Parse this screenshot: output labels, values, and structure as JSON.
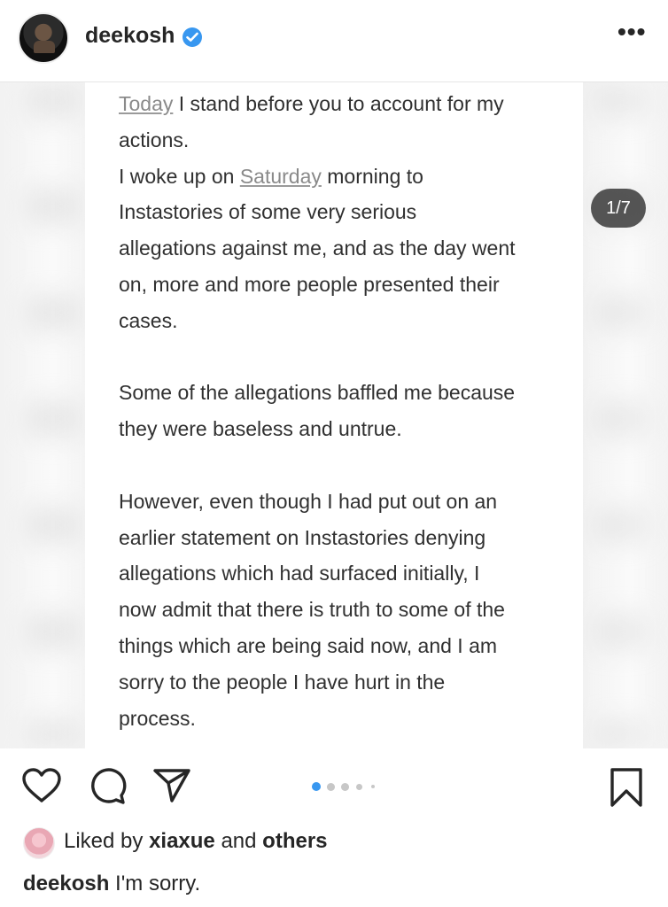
{
  "header": {
    "username": "deekosh",
    "more_label": "•••"
  },
  "media": {
    "counter": "1/7",
    "paragraphs": [
      [
        {
          "text": "Today",
          "underline": true
        },
        {
          "text": " I stand before you to account for my"
        },
        {
          "br": true
        },
        {
          "text": "actions."
        },
        {
          "br": true
        },
        {
          "text": "I woke up on "
        },
        {
          "text": "Saturday",
          "underline": true
        },
        {
          "text": " morning to"
        },
        {
          "br": true
        },
        {
          "text": "Instastories of some very serious"
        },
        {
          "br": true
        },
        {
          "text": "allegations against me, and as the day went"
        },
        {
          "br": true
        },
        {
          "text": "on, more and more people presented their"
        },
        {
          "br": true
        },
        {
          "text": "cases."
        }
      ],
      [
        {
          "text": "Some of the allegations baffled me because"
        },
        {
          "br": true
        },
        {
          "text": "they were baseless and untrue."
        }
      ],
      [
        {
          "text": "However, even though I had put out on an"
        },
        {
          "br": true
        },
        {
          "text": "earlier statement on Instastories denying"
        },
        {
          "br": true
        },
        {
          "text": "allegations which had surfaced initially, I"
        },
        {
          "br": true
        },
        {
          "text": "now admit that there is truth to some of the"
        },
        {
          "br": true
        },
        {
          "text": "things which are being said now, and I am"
        },
        {
          "br": true
        },
        {
          "text": "sorry to the people I have hurt in the"
        },
        {
          "br": true
        },
        {
          "text": "process."
        }
      ]
    ],
    "carousel_total": 7,
    "carousel_active_index": 0
  },
  "actions": {
    "icons": [
      "heart-icon",
      "comment-icon",
      "share-icon",
      "bookmark-icon"
    ]
  },
  "likes": {
    "prefix": "Liked by ",
    "user": "xiaxue",
    "connector": " and ",
    "others": "others"
  },
  "caption": {
    "username": "deekosh",
    "text": " I'm sorry."
  },
  "colors": {
    "verified_badge": "#3897f0",
    "active_dot": "#3897f0",
    "text": "#262626"
  }
}
